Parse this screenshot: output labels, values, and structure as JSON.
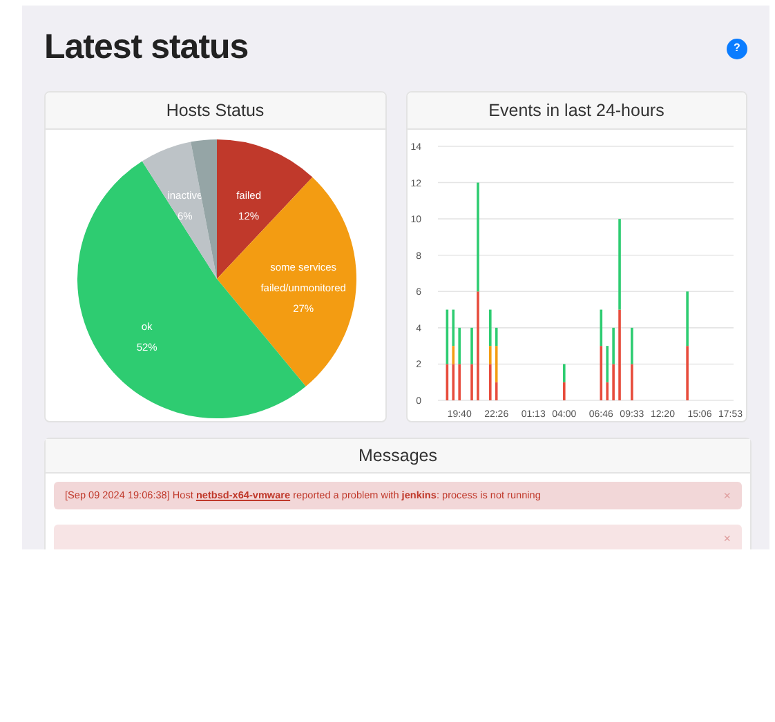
{
  "title": "Latest status",
  "help": {
    "label": "?"
  },
  "hosts_status": {
    "title": "Hosts Status",
    "chart_data": {
      "type": "pie",
      "categories": [
        "failed",
        "some services failed/unmonitored",
        "ok",
        "inactive",
        null
      ],
      "values": [
        12,
        27,
        52,
        6,
        3
      ],
      "colors": [
        "#c0392b",
        "#f39c12",
        "#2ecc71",
        "#bdc3c7",
        "#95a5a6"
      ],
      "value_labels": [
        "12%",
        "27%",
        "52%",
        "6%",
        null
      ]
    }
  },
  "events": {
    "title": "Events in last 24-hours",
    "chart_data": {
      "type": "bar",
      "stacked": true,
      "categories": [
        null,
        null,
        null,
        "19:40",
        null,
        null,
        null,
        null,
        null,
        "22:26",
        null,
        null,
        null,
        null,
        null,
        "01:13",
        null,
        null,
        null,
        null,
        "04:00",
        null,
        null,
        null,
        null,
        null,
        "06:46",
        null,
        null,
        null,
        null,
        "09:33",
        null,
        null,
        null,
        null,
        "12:20",
        null,
        null,
        null,
        null,
        null,
        "15:06",
        null,
        null,
        null,
        null,
        "17:53"
      ],
      "series": [
        {
          "color": "#e74c3c",
          "values": [
            0,
            2,
            2,
            2,
            0,
            2,
            6,
            0,
            2,
            1,
            0,
            0,
            0,
            0,
            0,
            0,
            0,
            0,
            0,
            0,
            1,
            0,
            0,
            0,
            0,
            0,
            3,
            1,
            2,
            5,
            0,
            2,
            0,
            0,
            0,
            0,
            0,
            0,
            0,
            0,
            3,
            0,
            0,
            0,
            0,
            0,
            0,
            0
          ]
        },
        {
          "color": "#f39c12",
          "values": [
            0,
            0,
            1,
            0,
            0,
            0,
            0,
            0,
            1,
            2,
            0,
            0,
            0,
            0,
            0,
            0,
            0,
            0,
            0,
            0,
            0,
            0,
            0,
            0,
            0,
            0,
            0,
            0,
            0,
            0,
            0,
            0,
            0,
            0,
            0,
            0,
            0,
            0,
            0,
            0,
            0,
            0,
            0,
            0,
            0,
            0,
            0,
            0
          ]
        },
        {
          "color": "#2ecc71",
          "values": [
            0,
            3,
            2,
            2,
            0,
            2,
            6,
            0,
            2,
            1,
            0,
            0,
            0,
            0,
            0,
            0,
            0,
            0,
            0,
            0,
            1,
            0,
            0,
            0,
            0,
            0,
            2,
            2,
            2,
            5,
            0,
            2,
            0,
            0,
            0,
            0,
            0,
            0,
            0,
            0,
            3,
            0,
            0,
            0,
            0,
            0,
            0,
            0
          ]
        }
      ],
      "ylim": [
        0,
        14
      ],
      "yticks": [
        0,
        2,
        4,
        6,
        8,
        10,
        12,
        14
      ],
      "grid": true
    }
  },
  "messages": {
    "title": "Messages",
    "items": [
      {
        "parts": [
          {
            "kind": "text",
            "text": "[Sep 09 2024 19:06:38] Host "
          },
          {
            "kind": "link",
            "text": "netbsd-x64-vmware"
          },
          {
            "kind": "text",
            "text": " reported a problem with "
          },
          {
            "kind": "bold",
            "text": "jenkins"
          },
          {
            "kind": "text",
            "text": ": process is not running"
          }
        ],
        "close": "×"
      },
      {
        "close": "×"
      }
    ]
  }
}
